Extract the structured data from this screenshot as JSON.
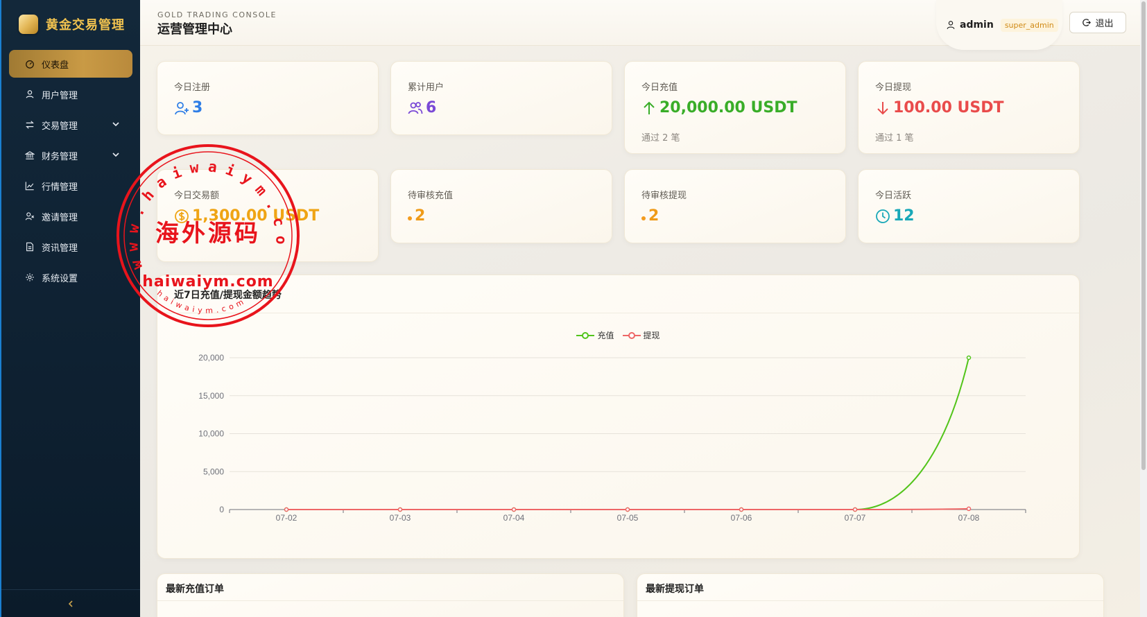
{
  "brand": {
    "title": "黄金交易管理"
  },
  "sidebar": {
    "items": [
      {
        "label": "仪表盘",
        "icon": "dashboard-icon",
        "active": true
      },
      {
        "label": "用户管理",
        "icon": "user-icon"
      },
      {
        "label": "交易管理",
        "icon": "exchange-icon",
        "expandable": true
      },
      {
        "label": "财务管理",
        "icon": "bank-icon",
        "expandable": true
      },
      {
        "label": "行情管理",
        "icon": "line-chart-icon"
      },
      {
        "label": "邀请管理",
        "icon": "invite-icon"
      },
      {
        "label": "资讯管理",
        "icon": "document-icon"
      },
      {
        "label": "系统设置",
        "icon": "gear-icon"
      }
    ],
    "collapse_icon": "chevron-left-icon"
  },
  "header": {
    "subtitle": "GOLD TRADING CONSOLE",
    "title": "运营管理中心",
    "user": {
      "name": "admin",
      "role": "super_admin"
    },
    "logout_label": "退出"
  },
  "stats": [
    {
      "label": "今日注册",
      "value": "3",
      "icon": "user-add-icon",
      "color": "#2f7ee6"
    },
    {
      "label": "累计用户",
      "value": "6",
      "icon": "users-icon",
      "color": "#7a49d6"
    },
    {
      "label": "今日充值",
      "value": "20,000.00 USDT",
      "icon": "arrow-up-icon",
      "color": "#39ad28",
      "sub": "通过 2 笔"
    },
    {
      "label": "今日提现",
      "value": "100.00 USDT",
      "icon": "arrow-down-icon",
      "color": "#e94b4b",
      "sub": "通过 1 笔"
    },
    {
      "label": "今日交易额",
      "value": "1,300.00 USDT",
      "icon": "dollar-circle-icon",
      "color": "#efa414"
    },
    {
      "label": "待审核充值",
      "value": "2",
      "color": "#ef9b19"
    },
    {
      "label": "待审核提现",
      "value": "2",
      "color": "#ef9b19"
    },
    {
      "label": "今日活跃",
      "value": "12",
      "icon": "clock-icon",
      "color": "#19a8b8"
    }
  ],
  "trend_card": {
    "title": "近7日充值/提现金额趋势"
  },
  "chart_data": {
    "type": "line",
    "title": "近7日充值/提现金额趋势",
    "x": [
      "07-02",
      "07-03",
      "07-04",
      "07-05",
      "07-06",
      "07-07",
      "07-08"
    ],
    "series": [
      {
        "name": "充值",
        "values": [
          0,
          0,
          0,
          0,
          0,
          0,
          20000
        ],
        "color": "#52c41a"
      },
      {
        "name": "提现",
        "values": [
          0,
          0,
          0,
          0,
          0,
          0,
          100
        ],
        "color": "#ee6666"
      }
    ],
    "ylim": [
      0,
      20000
    ],
    "yticks": [
      0,
      5000,
      10000,
      15000,
      20000
    ],
    "ytick_labels": [
      "0",
      "5,000",
      "10,000",
      "15,000",
      "20,000"
    ],
    "legend": "top-center",
    "grid": true,
    "smooth": true
  },
  "recent": {
    "recharge_title": "最新充值订单",
    "withdraw_title": "最新提现订单"
  },
  "watermark": {
    "outer_text": "www.haiwaiym.com",
    "center_text": "海外源码",
    "band_text": "haiwaiym.com",
    "inner_text": "haiwaiym.com",
    "color": "#e8141c"
  }
}
